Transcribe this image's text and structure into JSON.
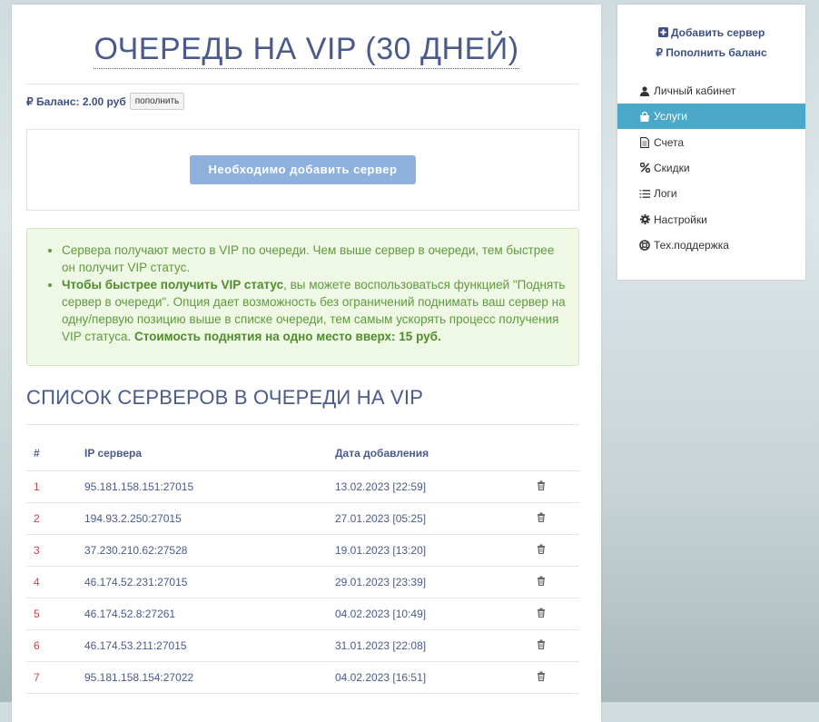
{
  "page": {
    "title": "ОЧЕРЕДЬ НА VIP (30 ДНЕЙ)",
    "balance_label": "₽ Баланс: 2.00 руб",
    "topup_button": "пополнить",
    "add_server_button": "Необходимо добавить сервер",
    "info": {
      "item1": "Сервера получают место в VIP по очереди. Чем выше сервер в очереди, тем быстрее он получит VIP статус.",
      "item2_bold": "Чтобы быстрее получить VIP статус",
      "item2_text": ", вы можете воспользоваться функцией \"Поднять сервер в очереди\". Опция дает возможность без ограничений поднимать ваш сервер на одну/первую позицию выше в списке очереди, тем самым ускорять процесс получения VIP статуса. ",
      "item2_bold_end": "Стоимость поднятия на одно место вверх: 15 руб."
    },
    "section_title": "СПИСОК СЕРВЕРОВ В ОЧЕРЕДИ НА VIP",
    "table": {
      "headers": [
        "#",
        "IP сервера",
        "Дата добавления"
      ],
      "rows": [
        {
          "num": "1",
          "ip": "95.181.158.151:27015",
          "date": "13.02.2023 [22:59]"
        },
        {
          "num": "2",
          "ip": "194.93.2.250:27015",
          "date": "27.01.2023 [05:25]"
        },
        {
          "num": "3",
          "ip": "37.230.210.62:27528",
          "date": "19.01.2023 [13:20]"
        },
        {
          "num": "4",
          "ip": "46.174.52.231:27015",
          "date": "29.01.2023 [23:39]"
        },
        {
          "num": "5",
          "ip": "46.174.52.8:27261",
          "date": "04.02.2023 [10:49]"
        },
        {
          "num": "6",
          "ip": "46.174.53.211:27015",
          "date": "31.01.2023 [22:08]"
        },
        {
          "num": "7",
          "ip": "95.181.158.154:27022",
          "date": "04.02.2023 [16:51]"
        }
      ]
    }
  },
  "sidebar": {
    "add_server": "Добавить сервер",
    "topup_balance": "Пополнить баланс",
    "items": [
      {
        "label": "Личный кабинет",
        "icon": "user-icon"
      },
      {
        "label": "Услуги",
        "icon": "shopping-bag-icon",
        "active": true
      },
      {
        "label": "Счета",
        "icon": "document-icon"
      },
      {
        "label": "Скидки",
        "icon": "percent-icon"
      },
      {
        "label": "Логи",
        "icon": "list-icon"
      },
      {
        "label": "Настройки",
        "icon": "gear-icon"
      },
      {
        "label": "Тех.поддержка",
        "icon": "lifebuoy-icon"
      }
    ]
  },
  "colors": {
    "accent": "#4ba8c9",
    "heading": "#4a5a8c",
    "info_bg": "#eef8e4",
    "info_text": "#5f9a3e",
    "button": "#8eb0dc"
  }
}
